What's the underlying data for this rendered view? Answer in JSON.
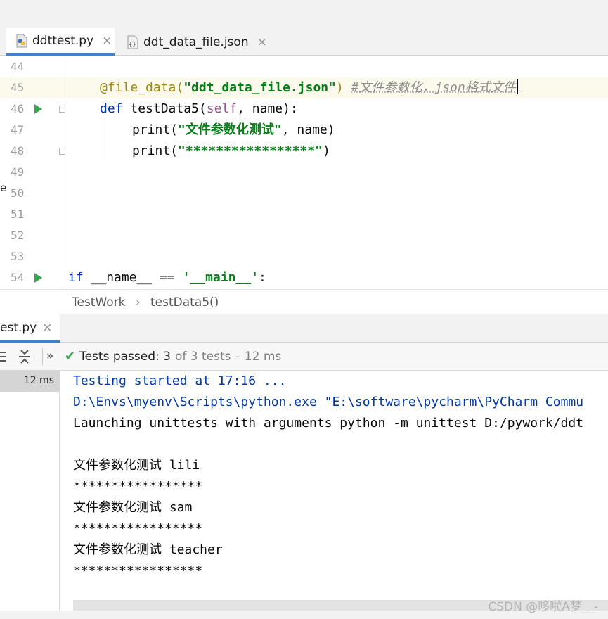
{
  "editor_tabs": [
    {
      "label": "ddttest.py",
      "icon": "python-file-icon",
      "active": true
    },
    {
      "label": "ddt_data_file.json",
      "icon": "json-file-icon",
      "active": false
    }
  ],
  "close_glyph": "×",
  "editor": {
    "line_numbers": [
      "44",
      "45",
      "46",
      "47",
      "48",
      "49",
      "50",
      "51",
      "52",
      "53",
      "54"
    ],
    "line45": {
      "decorator": "@file_data(",
      "arg": "\"ddt_data_file.json\"",
      "close": ")",
      "comment": "#文件参数化，json格式文件"
    },
    "line46": {
      "kw": "def",
      "name": " testData5(",
      "self": "self",
      "rest": ", name):"
    },
    "line47": {
      "fn": "print(",
      "str": "\"文件参数化测试\"",
      "rest": ", name)"
    },
    "line48": {
      "fn": "print(",
      "str": "\"*****************\"",
      "rest": ")"
    },
    "line54": {
      "kw": "if",
      "mid": " __name__ == ",
      "str": "'__main__'",
      "rest": ":"
    },
    "left_stray": "e"
  },
  "breadcrumb": {
    "items": [
      "TestWork",
      "testData5()"
    ],
    "separator": "›"
  },
  "run_tab": {
    "label": "est.py"
  },
  "run_toolbar": {
    "status_label": "Tests passed:",
    "passed": "3",
    "rest": "of 3 tests – 12 ms",
    "more": "»"
  },
  "test_tree": {
    "time": "12 ms"
  },
  "console_lines": [
    {
      "text": "Testing started at 17:16 ...",
      "sys": true
    },
    {
      "text": "D:\\Envs\\myenv\\Scripts\\python.exe \"E:\\software\\pycharm\\PyCharm Commu",
      "sys": true
    },
    {
      "text": "Launching unittests with arguments python -m unittest D:/pywork/ddt",
      "sys": false
    },
    {
      "text": "",
      "sys": false
    },
    {
      "text": "文件参数化测试 lili",
      "sys": false
    },
    {
      "text": "*****************",
      "sys": false
    },
    {
      "text": "文件参数化测试 sam",
      "sys": false
    },
    {
      "text": "*****************",
      "sys": false
    },
    {
      "text": "文件参数化测试 teacher",
      "sys": false
    },
    {
      "text": "*****************",
      "sys": false
    }
  ],
  "watermark": "CSDN @哆啦A梦__-",
  "colors": {
    "accent": "#4083c9",
    "run": "#3ba550",
    "string": "#067d17",
    "keyword": "#0033b3"
  }
}
